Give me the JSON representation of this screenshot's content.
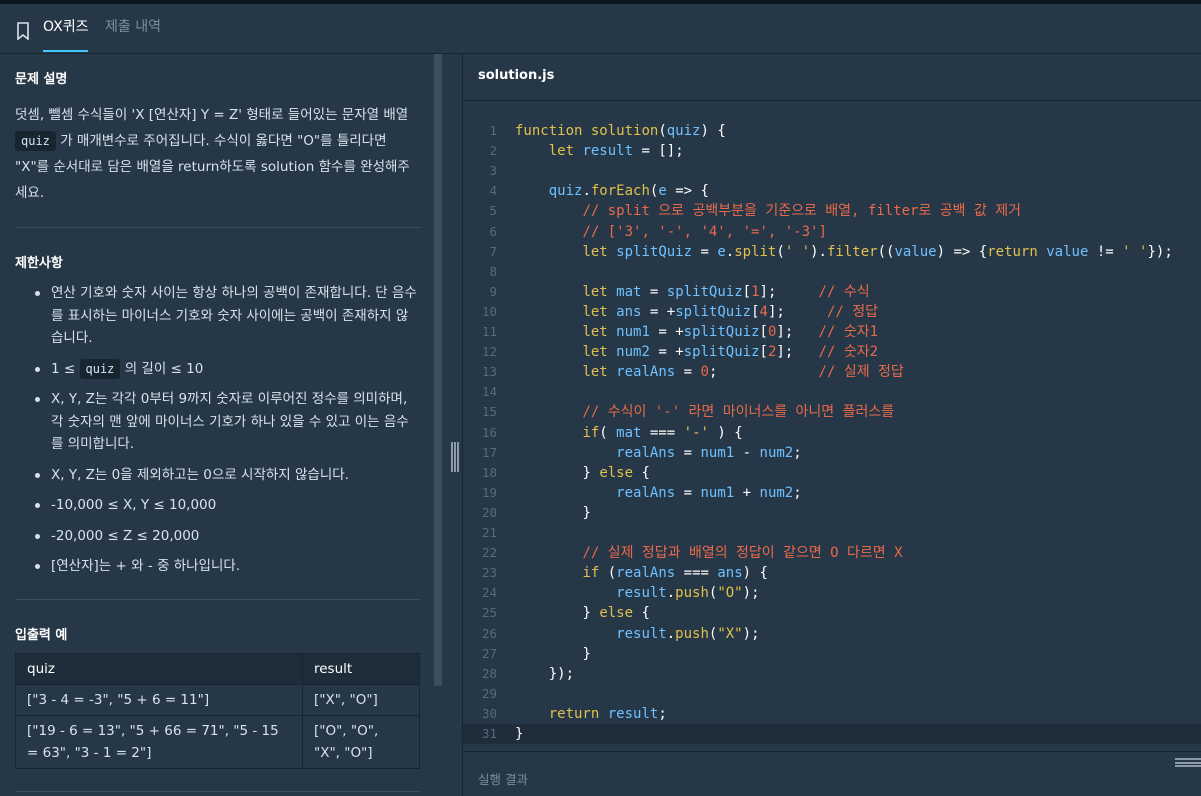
{
  "tabs": {
    "active": "OX퀴즈",
    "inactive": "제출 내역"
  },
  "problem": {
    "title": "문제 설명",
    "p1": "덧셈, 뺄셈 수식들이 'X [연산자] Y = Z' 형태로 들어있는 문자열 배열",
    "p1_code": "quiz",
    "p2": "가 매개변수로 주어집니다. 수식이 옳다면 \"O\"를 틀리다면",
    "p3": "\"X\"를 순서대로 담은 배열을 return하도록 solution 함수를 완성해주",
    "p4": "세요."
  },
  "limits": {
    "title": "제한사항",
    "items": [
      "연산 기호와 숫자 사이는 항상 하나의 공백이 존재합니다. 단 음수를 표시하는 마이너스 기호와 숫자 사이에는 공백이 존재하지 않습니다.",
      "의 길이 ≤ 10",
      "X, Y, Z는 각각 0부터 9까지 숫자로 이루어진 정수를 의미하며, 각 숫자의 맨 앞에 마이너스 기호가 하나 있을 수 있고 이는 음수를 의미합니다.",
      "X, Y, Z는 0을 제외하고는 0으로 시작하지 않습니다.",
      "-10,000 ≤ X, Y ≤ 10,000",
      "-20,000 ≤ Z ≤ 20,000",
      "[연산자]는 + 와 - 중 하나입니다."
    ],
    "item2_prefix": "1 ≤",
    "item2_code": "quiz"
  },
  "io": {
    "title": "입출력 예",
    "headers": [
      "quiz",
      "result"
    ],
    "rows": [
      [
        "[\"3 - 4 = -3\", \"5 + 6 = 11\"]",
        "[\"X\", \"O\"]"
      ],
      [
        "[\"19 - 6 = 13\", \"5 + 66 = 71\", \"5 - 15 = 63\", \"3 - 1 = 2\"]",
        "[\"O\", \"O\", \"X\", \"O\"]"
      ]
    ]
  },
  "editor": {
    "filename": "solution.js",
    "result_label": "실행 결과",
    "lines": [
      "function solution(quiz) {",
      "    let result = [];",
      "",
      "    quiz.forEach(e => {",
      "        // split 으로 공백부분을 기준으로 배열, filter로 공백 값 제거",
      "        // ['3', '-', '4', '=', '-3']",
      "        let splitQuiz = e.split(' ').filter((value) => {return value != ' '});",
      "",
      "        let mat = splitQuiz[1];     // 수식",
      "        let ans = +splitQuiz[4];     // 정답",
      "        let num1 = +splitQuiz[0];   // 숫자1",
      "        let num2 = +splitQuiz[2];   // 숫자2",
      "        let realAns = 0;            // 실제 정답",
      "",
      "        // 수식이 '-' 라면 마이너스를 아니면 플러스를",
      "        if( mat === '-' ) {",
      "            realAns = num1 - num2;",
      "        } else {",
      "            realAns = num1 + num2;",
      "        }",
      "",
      "        // 실제 정답과 배열의 정답이 같으면 O 다르면 X",
      "        if (realAns === ans) {",
      "            result.push(\"O\");",
      "        } else {",
      "            result.push(\"X\");",
      "        }",
      "    });",
      "",
      "    return result;",
      "}"
    ]
  }
}
